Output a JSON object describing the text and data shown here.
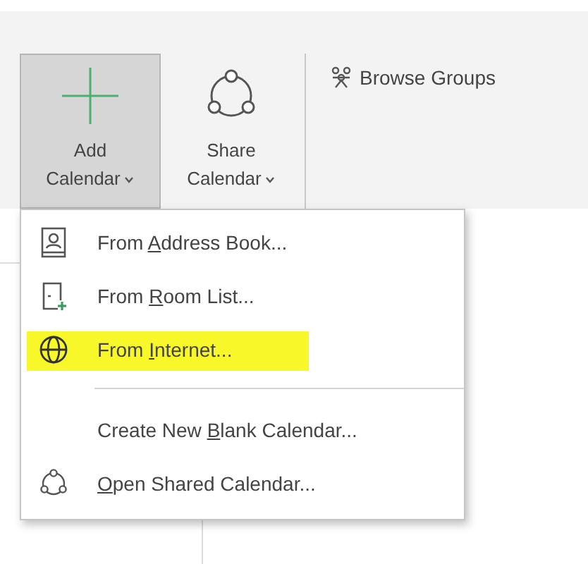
{
  "ribbon": {
    "buttons": [
      {
        "kind": "add",
        "line1": "Add",
        "line2": "Calendar",
        "pressed": true
      },
      {
        "kind": "share",
        "line1": "Share",
        "line2": "Calendar",
        "pressed": false
      }
    ],
    "browse_groups": "Browse Groups"
  },
  "menu": {
    "items": [
      {
        "kind": "address-book",
        "before": "From ",
        "key": "A",
        "after": "ddress Book...",
        "highlighted": false,
        "separator_before": false
      },
      {
        "kind": "room-list",
        "before": "From ",
        "key": "R",
        "after": "oom List...",
        "highlighted": false,
        "separator_before": false
      },
      {
        "kind": "globe",
        "before": "From ",
        "key": "I",
        "after": "nternet...",
        "highlighted": true,
        "separator_before": false
      },
      {
        "kind": "plain",
        "before": "Create New ",
        "key": "B",
        "after": "lank Calendar...",
        "highlighted": false,
        "separator_before": true
      },
      {
        "kind": "shared",
        "key": "O",
        "after": "pen Shared Calendar...",
        "highlighted": false,
        "separator_before": false
      }
    ]
  }
}
